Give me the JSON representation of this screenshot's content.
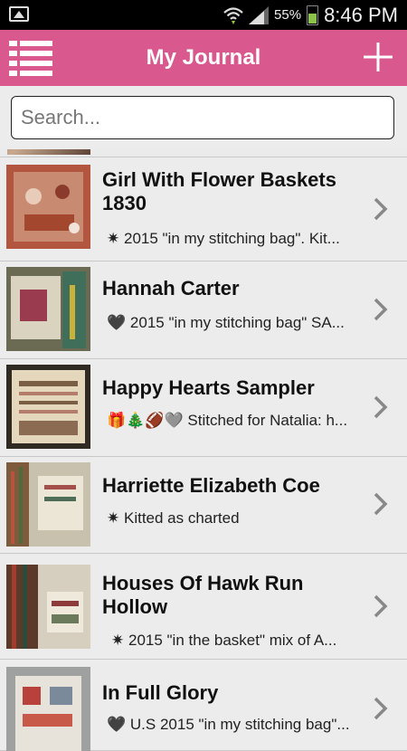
{
  "statusbar": {
    "battery_pct": "55%",
    "time": "8:46 PM"
  },
  "appbar": {
    "title": "My Journal"
  },
  "search": {
    "placeholder": "Search..."
  },
  "entries": [
    {
      "title": "Girl With Flower Baskets 1830",
      "icons": "✷",
      "note": "2015 \"in my stitching bag\". Kit..."
    },
    {
      "title": "Hannah Carter",
      "icons": "🖤",
      "note": "2015 \"in my stitching bag\" SA..."
    },
    {
      "title": "Happy Hearts Sampler",
      "icons": "🎁🎄🏈🩶",
      "note": "Stitched for Natalia: h..."
    },
    {
      "title": "Harriette Elizabeth Coe",
      "icons": "✷",
      "note": "Kitted as charted"
    },
    {
      "title": "Houses Of Hawk Run Hollow",
      "icons": "✷",
      "note": "2015 \"in the basket\" mix of A..."
    },
    {
      "title": "In Full Glory",
      "icons": "🖤 U.S",
      "note": "2015 \"in my stitching bag\"..."
    }
  ]
}
